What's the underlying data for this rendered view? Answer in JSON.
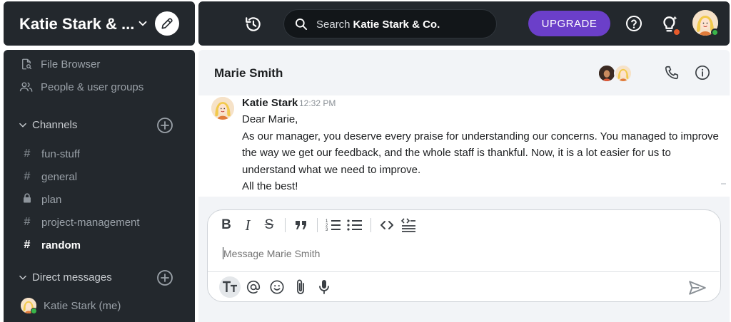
{
  "workspace": {
    "name": "Katie Stark & ..."
  },
  "topbar": {
    "search_placeholder": "Search",
    "search_scope": "Katie Stark & Co.",
    "upgrade_label": "UPGRADE"
  },
  "sidebar": {
    "nav": [
      {
        "label": "File Browser",
        "icon": "file-search-icon"
      },
      {
        "label": "People & user groups",
        "icon": "people-icon"
      }
    ],
    "channels_title": "Channels",
    "channels": [
      {
        "name": "fun-stuff",
        "icon": "hash-icon",
        "bold": false
      },
      {
        "name": "general",
        "icon": "hash-icon",
        "bold": false
      },
      {
        "name": "plan",
        "icon": "lock-icon",
        "bold": false
      },
      {
        "name": "project-management",
        "icon": "hash-icon",
        "bold": false
      },
      {
        "name": "random",
        "icon": "hash-icon",
        "bold": true
      }
    ],
    "dm_title": "Direct messages",
    "dms": [
      {
        "name": "Katie Stark (me)"
      }
    ]
  },
  "chat": {
    "title": "Marie Smith",
    "messages": [
      {
        "author": "Katie Stark",
        "time": "12:32 PM",
        "lines": [
          "Dear Marie,",
          "As our manager, you deserve every praise for understanding our concerns. You managed to improve the way we get our feedback, and the whole staff is thankful. Now, it is a lot easier for us to understand what we need to improve.",
          "All the best!"
        ]
      }
    ],
    "composer": {
      "placeholder": "Message Marie Smith"
    }
  },
  "colors": {
    "sidebar_bg": "#23282d",
    "accent": "#6b3fc9",
    "online": "#39b54a",
    "notification": "#e55a2b"
  }
}
